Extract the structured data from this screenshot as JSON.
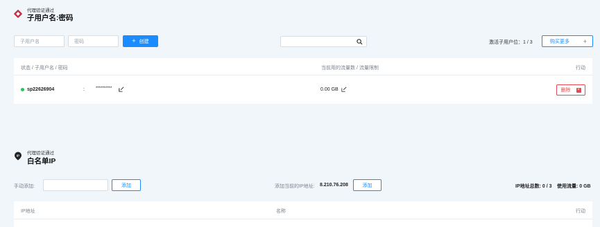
{
  "proxy_section": {
    "subtitle": "代理验证通过",
    "title": "子用户名:密码",
    "username_placeholder": "子用户名",
    "password_placeholder": "密码",
    "create_label": "创建",
    "active_sub_users_label": "激活子用户位：",
    "active_sub_users_value": "1 / 3",
    "buy_more_label": "购买更多",
    "table": {
      "col_status": "状态 / 子用户名 / 密码",
      "col_traffic": "当前用的流量数 / 流量限制",
      "col_action": "行动"
    },
    "row": {
      "username": "sp22626904",
      "separator": ":",
      "password": "**********",
      "traffic": "0.00 GB",
      "delete_label": "删除",
      "status_color": "#22c55e"
    }
  },
  "whitelist_section": {
    "subtitle": "代理验证通过",
    "title": "白名单IP",
    "manual_add_label": "手动添加:",
    "add_label": "添加",
    "current_ip_label": "添加当前的IP地址:",
    "current_ip": "8.210.76.208",
    "add_current_label": "添加",
    "ip_total_label": "IP地址总数: 0 / 3",
    "traffic_used_label": "使用流量: 0 GB",
    "table": {
      "col_ip": "IP地址",
      "col_name": "名称",
      "col_action": "行动"
    }
  },
  "colors": {
    "primary": "#1a8cff",
    "danger": "#e5484d",
    "background": "#f1f6fb"
  }
}
